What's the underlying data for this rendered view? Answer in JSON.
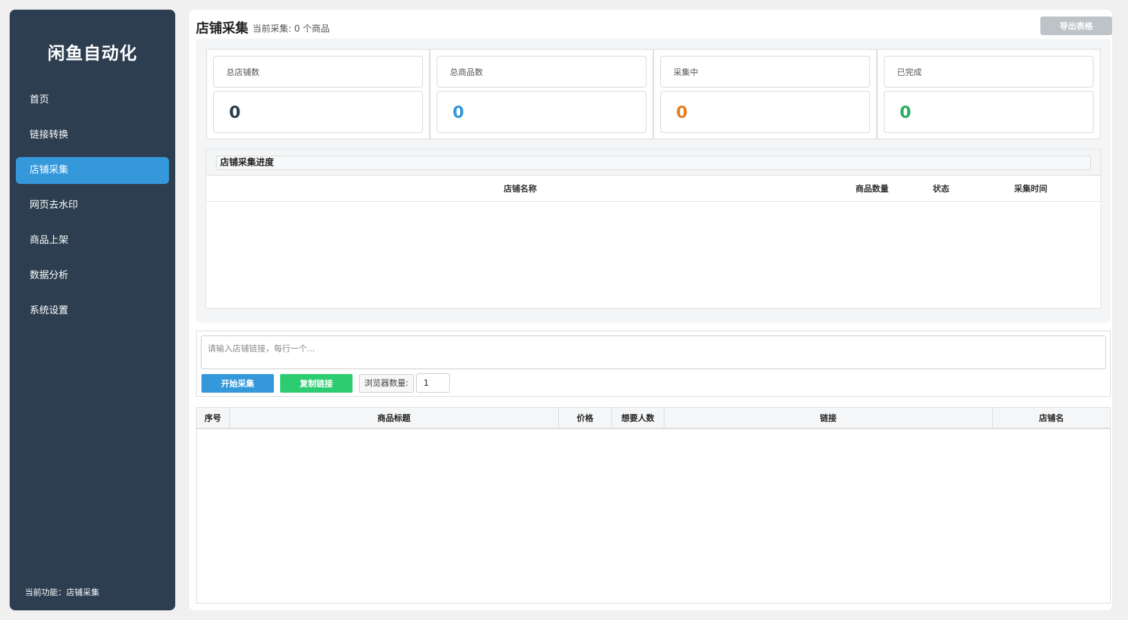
{
  "sidebar": {
    "brand": "闲鱼自动化",
    "items": [
      {
        "label": "首页",
        "active": false
      },
      {
        "label": "链接转换",
        "active": false
      },
      {
        "label": "店铺采集",
        "active": true
      },
      {
        "label": "网页去水印",
        "active": false
      },
      {
        "label": "商品上架",
        "active": false
      },
      {
        "label": "数据分析",
        "active": false
      },
      {
        "label": "系统设置",
        "active": false
      }
    ],
    "current_function": "当前功能：店铺采集"
  },
  "header": {
    "title": "店铺采集",
    "subtitle": "当前采集: 0 个商品",
    "export_label": "导出表格"
  },
  "stats": [
    {
      "label": "总店铺数",
      "value": "0",
      "color": "#2c3e50"
    },
    {
      "label": "总商品数",
      "value": "0",
      "color": "#3498db"
    },
    {
      "label": "采集中",
      "value": "0",
      "color": "#e67e22"
    },
    {
      "label": "已完成",
      "value": "0",
      "color": "#27ae60"
    }
  ],
  "progress": {
    "title": "店铺采集进度",
    "columns": [
      "店铺名称",
      "商品数量",
      "状态",
      "采集时间"
    ]
  },
  "input": {
    "placeholder": "请输入店铺链接，每行一个...",
    "start_label": "开始采集",
    "copy_label": "复制链接",
    "browser_label": "浏览器数量:",
    "browser_count": "1"
  },
  "results": {
    "columns": [
      "序号",
      "商品标题",
      "价格",
      "想要人数",
      "链接",
      "店铺名"
    ]
  },
  "colors": {
    "sidebar_bg": "#2c3e50",
    "accent": "#3498db",
    "success": "#2ecc71",
    "disabled": "#bdc3c7"
  }
}
